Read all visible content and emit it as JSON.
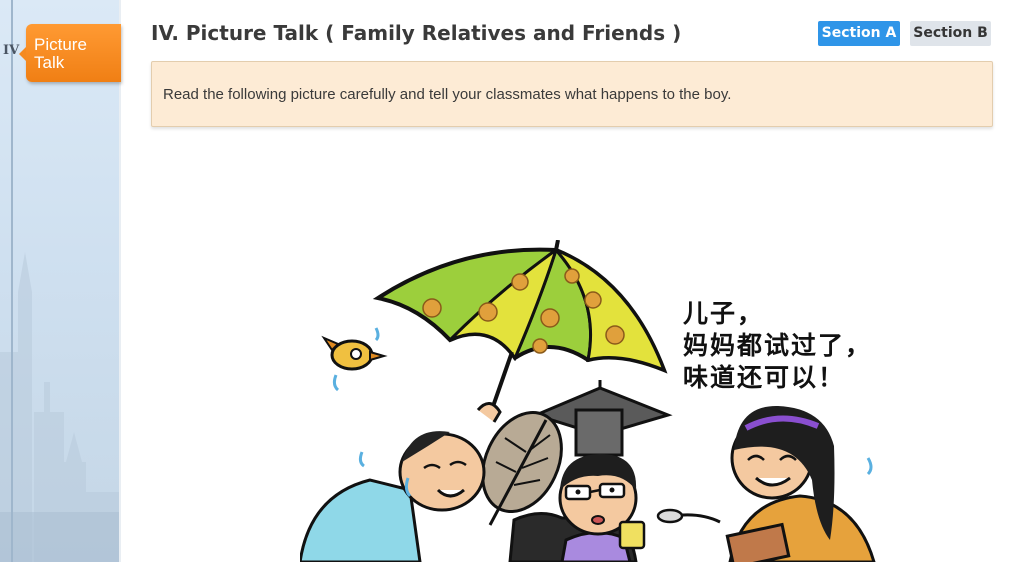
{
  "sidebar": {
    "roman_numeral": "IV",
    "active_item": {
      "label_line1": "Picture",
      "label_line2": "Talk",
      "color": "#f58a20"
    }
  },
  "header": {
    "title": "IV. Picture Talk ( Family Relatives and Friends )"
  },
  "sections": [
    {
      "label": "Section A",
      "active": true,
      "color": "#2f95e8"
    },
    {
      "label": "Section B",
      "active": false,
      "color": "#dfe4ea"
    }
  ],
  "instruction": {
    "text": "Read the following picture carefully and tell your classmates what happens to the boy."
  },
  "illustration": {
    "speech_lines": [
      "儿子，",
      "妈妈都试过了，",
      "味道还可以！"
    ]
  }
}
